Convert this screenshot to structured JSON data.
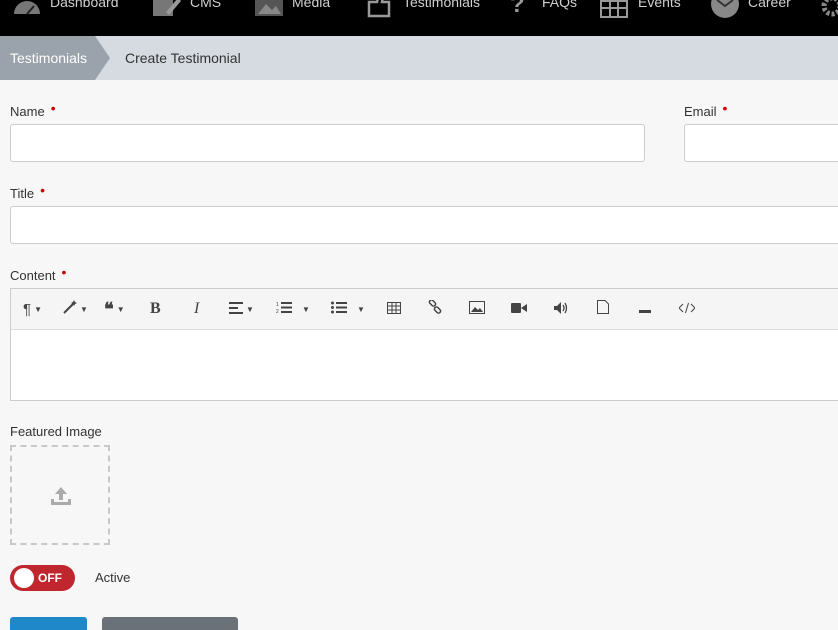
{
  "nav": {
    "items": [
      {
        "label": "Dashboard",
        "icon": "dashboard-icon"
      },
      {
        "label": "CMS",
        "icon": "cms-icon"
      },
      {
        "label": "Media",
        "icon": "media-icon"
      },
      {
        "label": "Testimonials",
        "icon": "testimonials-icon"
      },
      {
        "label": "FAQs",
        "icon": "faq-icon"
      },
      {
        "label": "Events",
        "icon": "calendar-icon"
      },
      {
        "label": "Career",
        "icon": "career-icon"
      }
    ],
    "settings_icon": "gear-icon"
  },
  "breadcrumb": {
    "parent": "Testimonials",
    "current": "Create Testimonial"
  },
  "form": {
    "name_label": "Name",
    "email_label": "Email",
    "title_label": "Title",
    "content_label": "Content",
    "required_mark": "•",
    "name_value": "",
    "email_value": "",
    "title_value": "",
    "featured_image_label": "Featured Image",
    "toggle_state": "OFF",
    "active_label": "Active"
  },
  "editor_toolbar": [
    "paragraph-icon",
    "magic-icon",
    "quote-icon",
    "bold-icon",
    "italic-icon",
    "align-icon",
    "ordered-list-icon",
    "unordered-list-icon",
    "table-icon",
    "link-icon",
    "image-icon",
    "video-icon",
    "audio-icon",
    "file-icon",
    "horizontal-rule-icon",
    "code-view-icon"
  ],
  "colors": {
    "nav_bg": "#000000",
    "breadcrumb_bg": "#d5dbe0",
    "breadcrumb_active": "#9aa3ab",
    "required": "#cc0000",
    "toggle_off": "#c0262d",
    "primary": "#1e88c8",
    "secondary": "#6b7178"
  }
}
